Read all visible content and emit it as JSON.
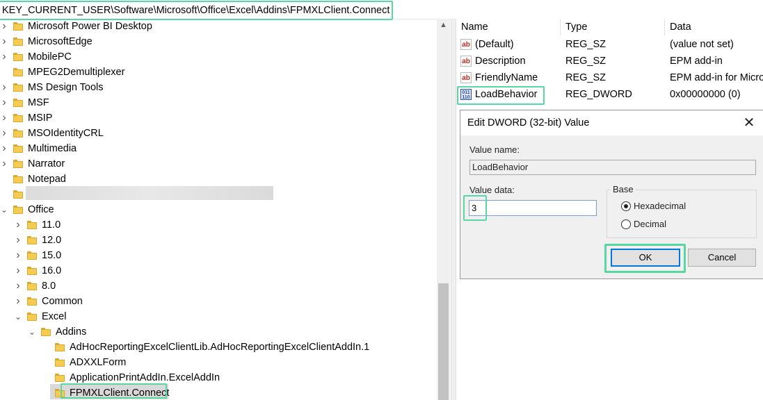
{
  "address_bar": {
    "path": "KEY_CURRENT_USER\\Software\\Microsoft\\Office\\Excel\\Addins\\FPMXLClient.Connect"
  },
  "tree": {
    "items": [
      {
        "label": "Microsoft Power BI Desktop",
        "level": 0,
        "expander": "collapsed"
      },
      {
        "label": "MicrosoftEdge",
        "level": 0,
        "expander": "collapsed"
      },
      {
        "label": "MobilePC",
        "level": 0,
        "expander": "collapsed"
      },
      {
        "label": "MPEG2Demultiplexer",
        "level": 0,
        "expander": "none"
      },
      {
        "label": "MS Design Tools",
        "level": 0,
        "expander": "collapsed"
      },
      {
        "label": "MSF",
        "level": 0,
        "expander": "collapsed"
      },
      {
        "label": "MSIP",
        "level": 0,
        "expander": "collapsed"
      },
      {
        "label": "MSOIdentityCRL",
        "level": 0,
        "expander": "collapsed"
      },
      {
        "label": "Multimedia",
        "level": 0,
        "expander": "collapsed"
      },
      {
        "label": "Narrator",
        "level": 0,
        "expander": "collapsed"
      },
      {
        "label": "Notepad",
        "level": 0,
        "expander": "none"
      },
      {
        "label": "",
        "level": 0,
        "expander": "none"
      },
      {
        "label": "Office",
        "level": 0,
        "expander": "expanded"
      },
      {
        "label": "11.0",
        "level": 1,
        "expander": "collapsed"
      },
      {
        "label": "12.0",
        "level": 1,
        "expander": "collapsed"
      },
      {
        "label": "15.0",
        "level": 1,
        "expander": "collapsed"
      },
      {
        "label": "16.0",
        "level": 1,
        "expander": "collapsed"
      },
      {
        "label": "8.0",
        "level": 1,
        "expander": "collapsed"
      },
      {
        "label": "Common",
        "level": 1,
        "expander": "collapsed"
      },
      {
        "label": "Excel",
        "level": 1,
        "expander": "expanded"
      },
      {
        "label": "Addins",
        "level": 2,
        "expander": "expanded"
      },
      {
        "label": "AdHocReportingExcelClientLib.AdHocReportingExcelClientAddIn.1",
        "level": 3,
        "expander": "none"
      },
      {
        "label": "ADXXLForm",
        "level": 3,
        "expander": "none"
      },
      {
        "label": "ApplicationPrintAddIn.ExcelAddIn",
        "level": 3,
        "expander": "none"
      },
      {
        "label": "FPMXLClient.Connect",
        "level": 3,
        "expander": "none"
      }
    ]
  },
  "values_pane": {
    "columns": {
      "name": "Name",
      "type": "Type",
      "data": "Data"
    },
    "rows": [
      {
        "icon": "string-value-icon",
        "icon_text": "ab",
        "name": "(Default)",
        "type": "REG_SZ",
        "data": "(value not set)"
      },
      {
        "icon": "string-value-icon",
        "icon_text": "ab",
        "name": "Description",
        "type": "REG_SZ",
        "data": "EPM add-in"
      },
      {
        "icon": "string-value-icon",
        "icon_text": "ab",
        "name": "FriendlyName",
        "type": "REG_SZ",
        "data": "EPM add-in for Micro"
      },
      {
        "icon": "binary-value-icon",
        "icon_text": "011\n110",
        "name": "LoadBehavior",
        "type": "REG_DWORD",
        "data": "0x00000000 (0)"
      }
    ]
  },
  "dialog": {
    "title": "Edit DWORD (32-bit) Value",
    "close_glyph": "✕",
    "value_name_label": "Value name:",
    "value_name": "LoadBehavior",
    "value_data_label": "Value data:",
    "value_data": "3",
    "base_label": "Base",
    "base_options": [
      {
        "label": "Hexadecimal",
        "selected": true
      },
      {
        "label": "Decimal",
        "selected": false
      }
    ],
    "ok_label": "OK",
    "cancel_label": "Cancel"
  },
  "scrollbar": {
    "up_glyph": "▲"
  },
  "colors": {
    "highlight": "#59d7a3",
    "folder": "#f5cc52",
    "selection": "#d9d9d9",
    "focus": "#0078d7"
  }
}
